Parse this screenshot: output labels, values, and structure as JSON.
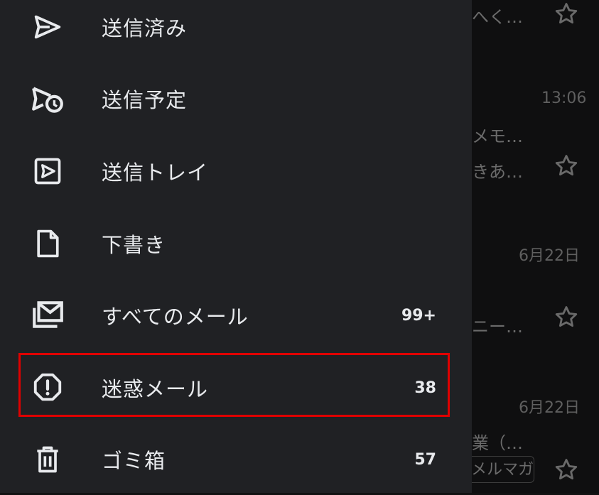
{
  "drawer": {
    "items": [
      {
        "label": "送信済み",
        "icon": "send-icon",
        "count": ""
      },
      {
        "label": "送信予定",
        "icon": "scheduled-send-icon",
        "count": ""
      },
      {
        "label": "送信トレイ",
        "icon": "outbox-icon",
        "count": ""
      },
      {
        "label": "下書き",
        "icon": "draft-icon",
        "count": ""
      },
      {
        "label": "すべてのメール",
        "icon": "all-mail-icon",
        "count": "99+"
      },
      {
        "label": "迷惑メール",
        "icon": "spam-icon",
        "count": "38"
      },
      {
        "label": "ゴミ箱",
        "icon": "trash-icon",
        "count": "57"
      }
    ],
    "highlighted_item": "迷惑メール",
    "highlight_color": "#e00000"
  },
  "background_inbox": {
    "snippets": [
      "へく…",
      "メモ…",
      "きあ…",
      "ニー…",
      "業（…"
    ],
    "dates": [
      "13:06",
      "6月22日",
      "6月22日"
    ],
    "chip": "メルマガ"
  }
}
